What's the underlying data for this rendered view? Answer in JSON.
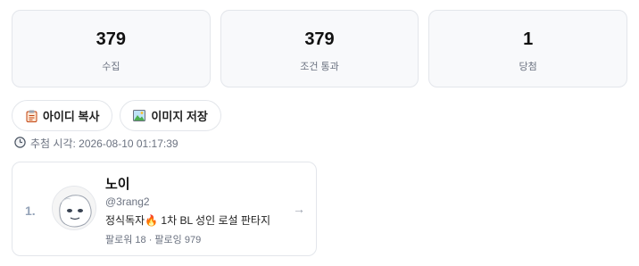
{
  "stats": [
    {
      "value": "379",
      "label": "수집"
    },
    {
      "value": "379",
      "label": "조건 통과"
    },
    {
      "value": "1",
      "label": "당첨"
    }
  ],
  "actions": {
    "copy_ids_label": "아이디 복사",
    "save_image_label": "이미지 저장"
  },
  "draw_time": {
    "text": "추첨 시각: 2026-08-10 01:17:39"
  },
  "winner": {
    "rank": "1.",
    "name": "노이",
    "handle": "@3rang2",
    "bio": "정식독자🔥 1차 BL 성인 로설 판타지",
    "follow_info": "팔로워 18 · 팔로잉 979",
    "arrow": "→"
  },
  "icons": {
    "copy": "clipboard-icon",
    "save": "image-icon",
    "time": "clock-icon"
  }
}
